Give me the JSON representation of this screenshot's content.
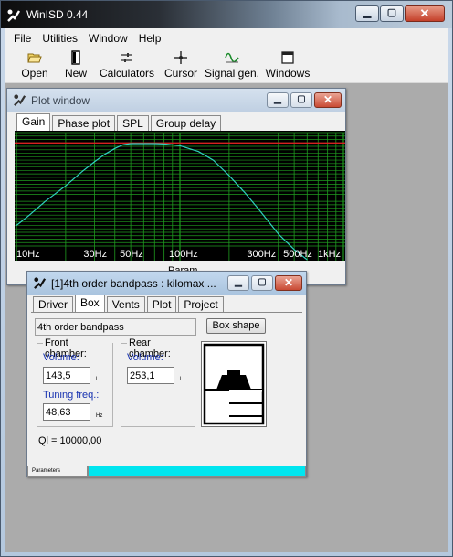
{
  "app": {
    "title": "WinISD 0.44"
  },
  "menu": [
    "File",
    "Utilities",
    "Window",
    "Help"
  ],
  "toolbar": [
    {
      "label": "Open",
      "icon": "folder-icon"
    },
    {
      "label": "New",
      "icon": "speaker-new-icon"
    },
    {
      "label": "Calculators",
      "icon": "sliders-icon"
    },
    {
      "label": "Cursor",
      "icon": "crosshair-icon"
    },
    {
      "label": "Signal gen.",
      "icon": "sine-wave-icon"
    },
    {
      "label": "Windows",
      "icon": "window-icon"
    }
  ],
  "plot_window": {
    "title": "Plot window",
    "tabs": [
      "Gain",
      "Phase plot",
      "SPL",
      "Group delay"
    ],
    "selected_tab": "Gain",
    "hidden_fragment": "Param"
  },
  "chart_data": {
    "type": "line",
    "title": "",
    "xlabel": "",
    "ylabel": "",
    "x_scale": "log",
    "xlim": [
      10,
      1000
    ],
    "x_ticks": [
      {
        "value": 10,
        "label": "10Hz"
      },
      {
        "value": 30,
        "label": "30Hz"
      },
      {
        "value": 50,
        "label": "50Hz"
      },
      {
        "value": 100,
        "label": "100Hz"
      },
      {
        "value": 300,
        "label": "300Hz"
      },
      {
        "value": 500,
        "label": "500Hz"
      },
      {
        "value": 1000,
        "label": "1kHz"
      }
    ],
    "grid": true,
    "colors": {
      "background": "#000000",
      "grid": "#1f9a1f",
      "curve": "#2fd0c0",
      "reference": "#d42020"
    },
    "reference_level": 0,
    "ylim": [
      -30,
      3
    ],
    "series": [
      {
        "x": [
          10,
          12,
          15,
          20,
          25,
          30,
          35,
          40,
          45,
          50,
          55,
          60,
          70,
          80,
          100,
          130,
          160,
          200,
          250,
          300,
          350,
          400,
          500,
          600
        ],
        "values": [
          -24,
          -21,
          -17,
          -12.5,
          -8.5,
          -5.5,
          -3.2,
          -1.6,
          -0.5,
          -0.2,
          -0.2,
          -0.2,
          -0.2,
          -0.3,
          -0.8,
          -2.5,
          -5,
          -9.5,
          -14.5,
          -19,
          -23,
          -26.5,
          -31,
          -34
        ]
      }
    ]
  },
  "bandpass_window": {
    "title": "[1]4th order bandpass : kilomax ...",
    "tabs": [
      "Driver",
      "Box",
      "Vents",
      "Plot",
      "Project"
    ],
    "selected_tab": "Box",
    "box_type": "4th order bandpass",
    "box_shape_button": "Box shape",
    "front": {
      "title": "Front chamber:",
      "volume_label": "Volume:",
      "volume": "143,5",
      "volume_unit": "l",
      "tuning_label": "Tuning freq.:",
      "tuning": "48,63",
      "tuning_unit": "Hz"
    },
    "rear": {
      "title": "Rear chamber:",
      "volume_label": "Volume:",
      "volume": "253,1",
      "volume_unit": "l"
    },
    "ql": "Ql = 10000,00",
    "status_tab": "Parameters",
    "status_color": "#00e5ef"
  }
}
